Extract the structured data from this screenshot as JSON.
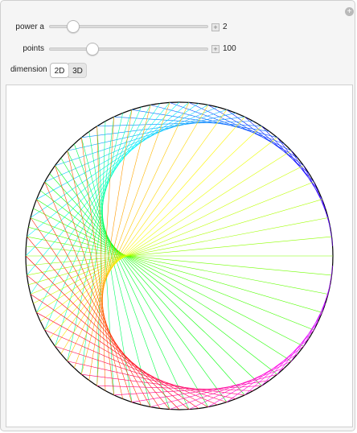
{
  "controls": {
    "power": {
      "label": "power a",
      "value": "2",
      "fraction": 0.12
    },
    "points": {
      "label": "points",
      "value": "100",
      "fraction": 0.25
    },
    "dimension": {
      "label": "dimension",
      "options": [
        "2D",
        "3D"
      ],
      "selected": "2D"
    }
  },
  "plot": {
    "curve": "times-table cardioid",
    "multiplier": 2,
    "num_points": 100,
    "circle_color": "#000000",
    "line_color_mode": "hue-by-index"
  }
}
